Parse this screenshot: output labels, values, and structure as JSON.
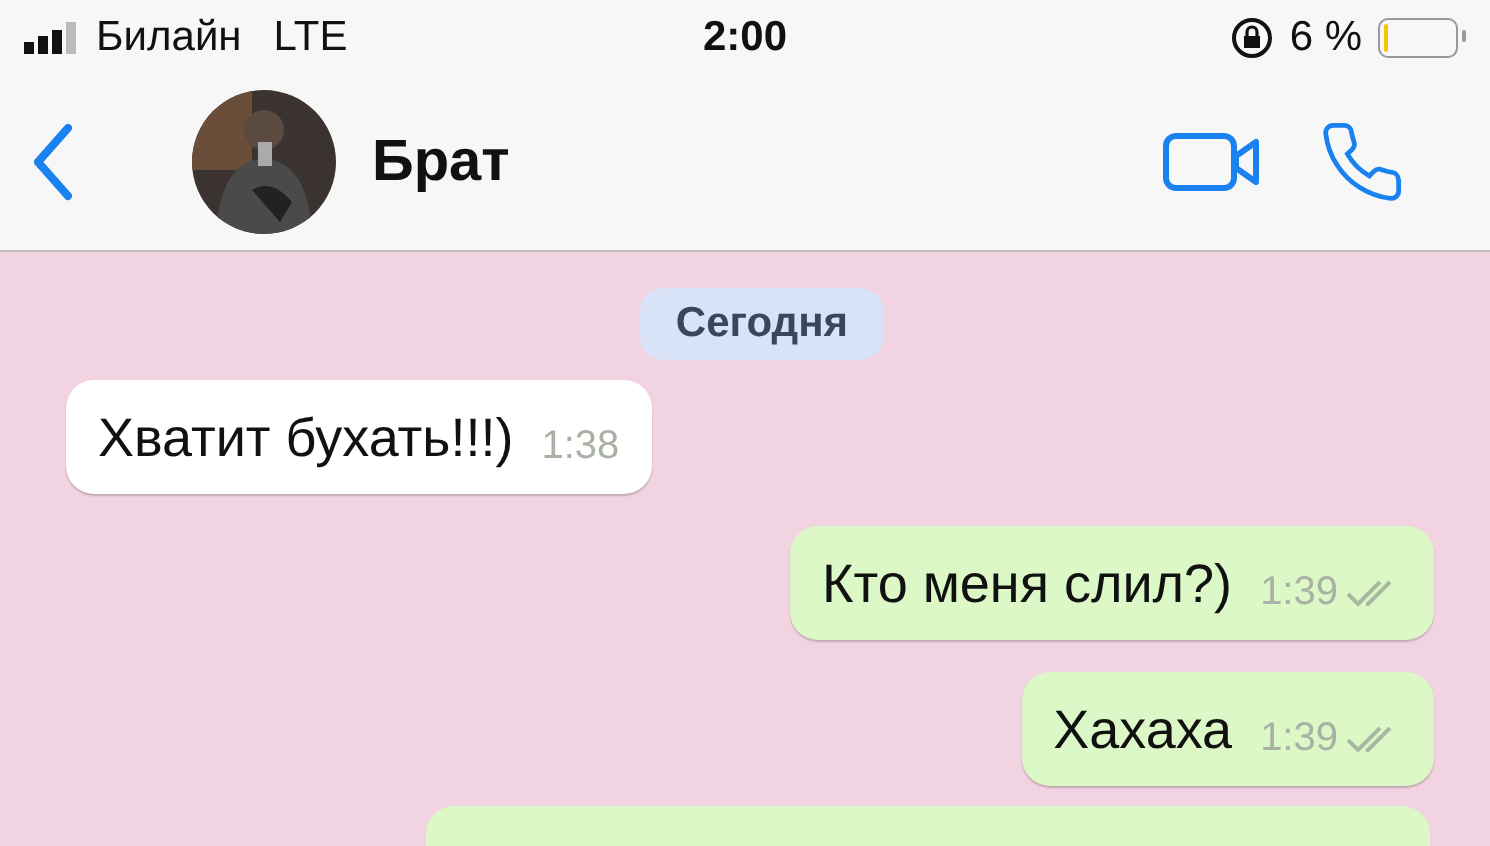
{
  "status_bar": {
    "carrier": "Билайн",
    "network": "LTE",
    "time": "2:00",
    "battery": {
      "text": "6 %",
      "level": 0.06
    }
  },
  "chat_header": {
    "contact_name": "Брат"
  },
  "date_label": "Сегодня",
  "messages": [
    {
      "kind": "incoming",
      "text": "Хватит бухать!!!)",
      "time": "1:38"
    },
    {
      "kind": "outgoing",
      "text": "Кто меня слил?)",
      "time": "1:39",
      "read": true
    },
    {
      "kind": "outgoing",
      "text": "Хахаха",
      "time": "1:39",
      "read": true
    }
  ]
}
